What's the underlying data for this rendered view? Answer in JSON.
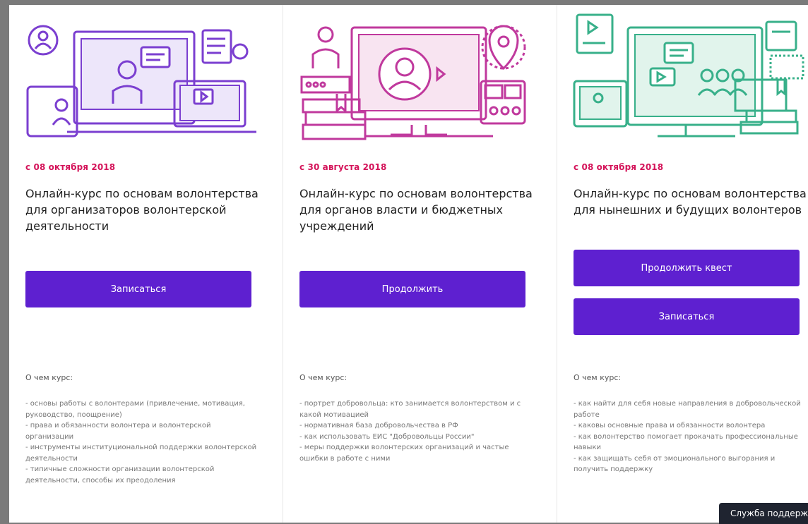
{
  "courses": [
    {
      "date": "с 08 октября 2018",
      "title": "Онлайн-курс по основам волонтерства для организаторов волонтерской деятельности",
      "buttons": [
        "Записаться"
      ],
      "about_label": "О чем курс:",
      "bullets": [
        "- основы работы с волонтерами (привлечение, мотивация, руководство, поощрение)",
        "- права и обязанности волонтера и волонтерской организации",
        "- инструменты институциональной поддержки волонтерской деятельности",
        "- типичные сложности организации волонтерской деятельности, способы их преодоления"
      ]
    },
    {
      "date": "с 30 августа 2018",
      "title": "Онлайн-курс по основам волонтерства для органов власти и бюджетных учреждений",
      "buttons": [
        "Продолжить"
      ],
      "about_label": "О чем курс:",
      "bullets": [
        "- портрет добровольца: кто занимается волонтерством и с какой мотивацией",
        "- нормативная база добровольчества в РФ",
        "- как использовать ЕИС \"Добровольцы России\"",
        "- меры поддержки волонтерских организаций и частые ошибки в работе с ними"
      ]
    },
    {
      "date": "с 08 октября 2018",
      "title": "Онлайн-курс по основам волонтерства для нынешних и будущих волонтеров",
      "buttons": [
        "Продолжить квест",
        "Записаться"
      ],
      "about_label": "О чем курс:",
      "bullets": [
        "- как найти для себя новые направления в добровольческой работе",
        "- каковы основные права и обязанности волонтера",
        "- как волонтерство помогает прокачать профессиональные навыки",
        "- как защищать себя от эмоционального выгорания и получить поддержку"
      ]
    }
  ],
  "support_tab": "Служба поддерж",
  "colors": {
    "accent_button": "#5e20d0",
    "date": "#d4145a",
    "illustration_1": "#7b3fd0",
    "illustration_2": "#c0399d",
    "illustration_3": "#38b08a"
  },
  "illustrations": [
    "video-course-illustration",
    "government-course-illustration",
    "volunteer-course-illustration"
  ]
}
